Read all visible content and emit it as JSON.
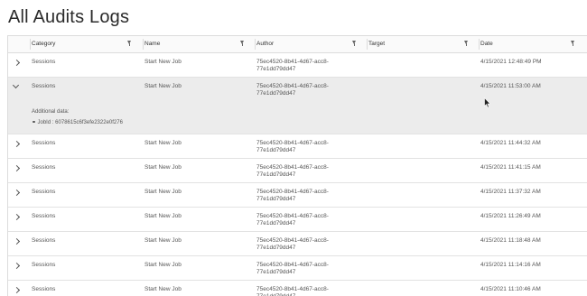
{
  "page": {
    "title": "All Audits Logs"
  },
  "columns": [
    {
      "label": "Category"
    },
    {
      "label": "Name"
    },
    {
      "label": "Author"
    },
    {
      "label": "Target"
    },
    {
      "label": "Date"
    }
  ],
  "rows": [
    {
      "category": "Sessions",
      "name": "Start New Job",
      "author_line1": "75ec4520-8b41-4d67-acc8-",
      "author_line2": "77e1dd79dd47",
      "target": "",
      "date": "4/15/2021 12:48:49 PM",
      "expanded": false
    },
    {
      "category": "Sessions",
      "name": "Start New Job",
      "author_line1": "75ec4520-8b41-4d67-acc8-",
      "author_line2": "77e1dd79dd47",
      "target": "",
      "date": "4/15/2021 11:53:00 AM",
      "expanded": true,
      "details": {
        "title": "Additional data:",
        "items": [
          "JobId : 6078615c6f3efe2322e0f276"
        ]
      }
    },
    {
      "category": "Sessions",
      "name": "Start New Job",
      "author_line1": "75ec4520-8b41-4d67-acc8-",
      "author_line2": "77e1dd79dd47",
      "target": "",
      "date": "4/15/2021 11:44:32 AM",
      "expanded": false
    },
    {
      "category": "Sessions",
      "name": "Start New Job",
      "author_line1": "75ec4520-8b41-4d67-acc8-",
      "author_line2": "77e1dd79dd47",
      "target": "",
      "date": "4/15/2021 11:41:15 AM",
      "expanded": false
    },
    {
      "category": "Sessions",
      "name": "Start New Job",
      "author_line1": "75ec4520-8b41-4d67-acc8-",
      "author_line2": "77e1dd79dd47",
      "target": "",
      "date": "4/15/2021 11:37:32 AM",
      "expanded": false
    },
    {
      "category": "Sessions",
      "name": "Start New Job",
      "author_line1": "75ec4520-8b41-4d67-acc8-",
      "author_line2": "77e1dd79dd47",
      "target": "",
      "date": "4/15/2021 11:26:49 AM",
      "expanded": false
    },
    {
      "category": "Sessions",
      "name": "Start New Job",
      "author_line1": "75ec4520-8b41-4d67-acc8-",
      "author_line2": "77e1dd79dd47",
      "target": "",
      "date": "4/15/2021 11:18:48 AM",
      "expanded": false
    },
    {
      "category": "Sessions",
      "name": "Start New Job",
      "author_line1": "75ec4520-8b41-4d67-acc8-",
      "author_line2": "77e1dd79dd47",
      "target": "",
      "date": "4/15/2021 11:14:16 AM",
      "expanded": false
    },
    {
      "category": "Sessions",
      "name": "Start New Job",
      "author_line1": "75ec4520-8b41-4d67-acc8-",
      "author_line2": "77e1dd79dd47",
      "target": "",
      "date": "4/15/2021 11:10:46 AM",
      "expanded": false
    }
  ],
  "icons": {
    "expand": "chevron-right-icon",
    "collapse": "chevron-down-icon",
    "filter": "filter-icon",
    "cursor": "mouse-pointer-icon"
  }
}
